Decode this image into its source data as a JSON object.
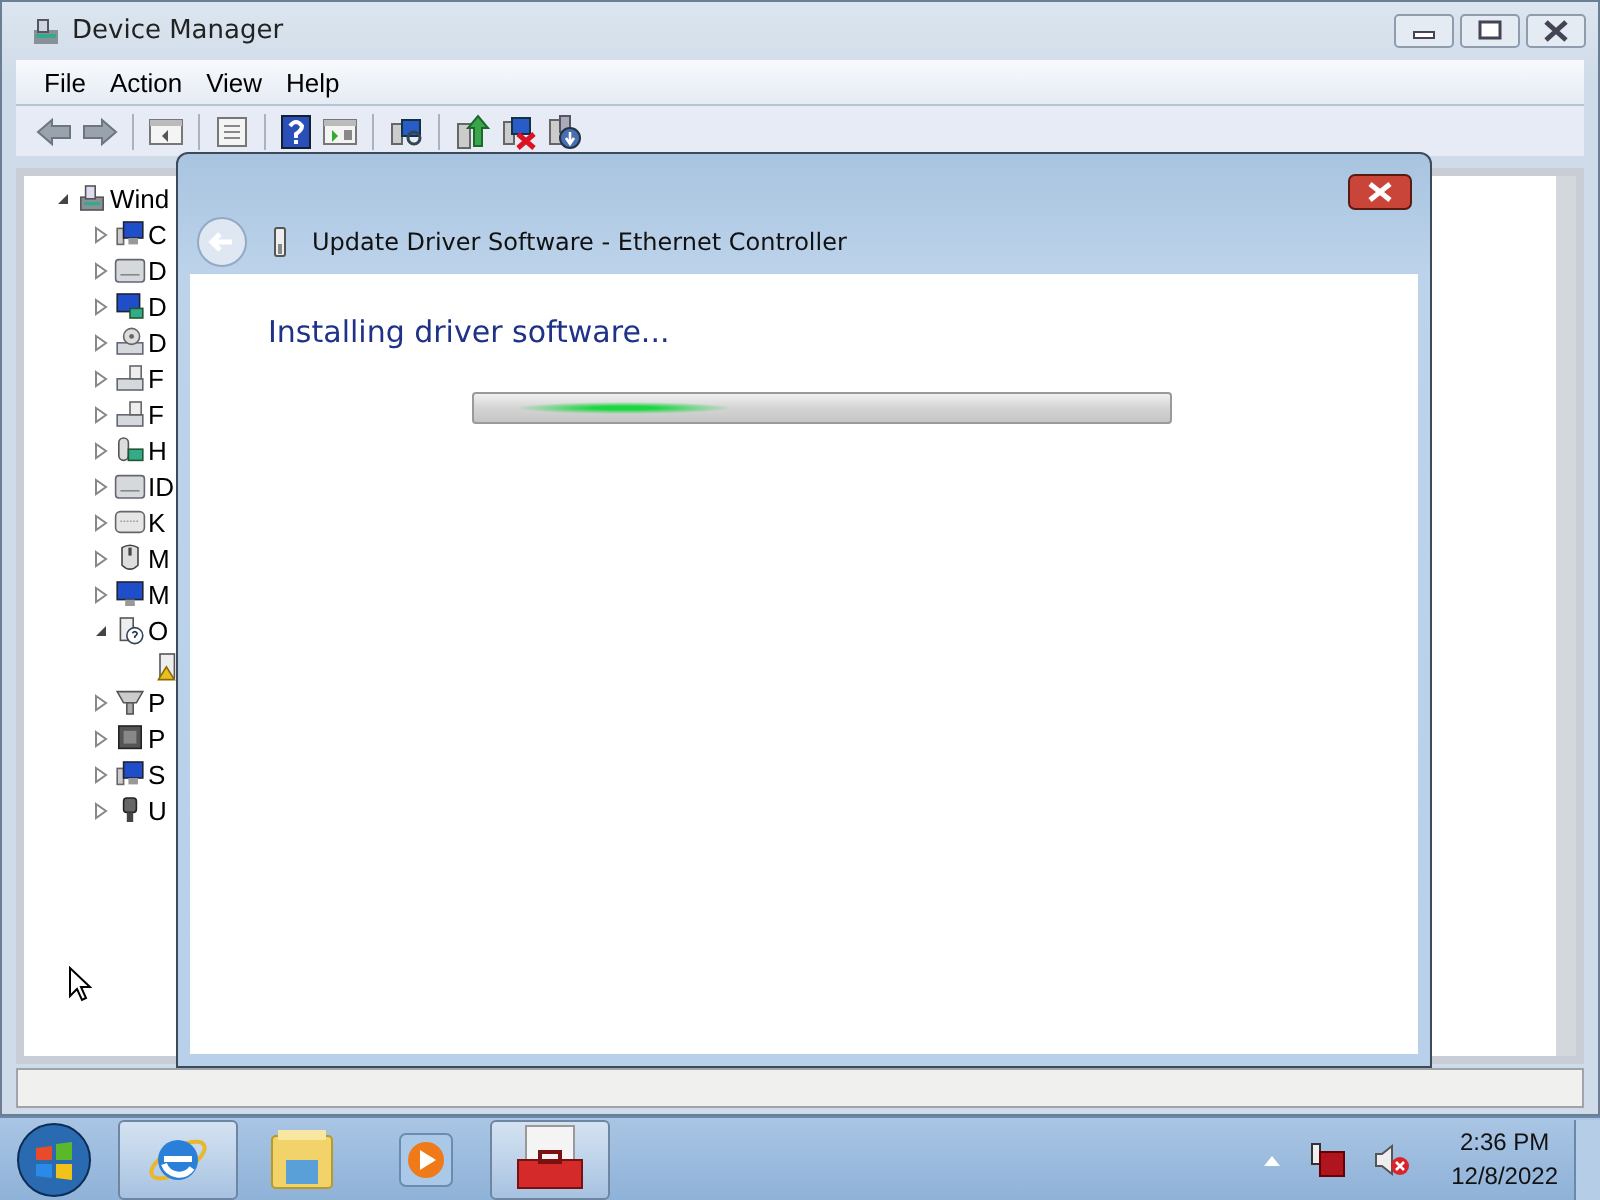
{
  "main_window": {
    "title": "Device Manager",
    "menu": [
      "File",
      "Action",
      "View",
      "Help"
    ],
    "tree": [
      {
        "label": "Wind",
        "kind": "computer-root",
        "expanded": true,
        "children": [
          {
            "label": "C",
            "kind": "computer",
            "expanded": false
          },
          {
            "label": "D",
            "kind": "disk",
            "expanded": false
          },
          {
            "label": "D",
            "kind": "display",
            "expanded": false
          },
          {
            "label": "D",
            "kind": "dvd",
            "expanded": false
          },
          {
            "label": "F",
            "kind": "floppy",
            "expanded": false
          },
          {
            "label": "F",
            "kind": "floppy",
            "expanded": false
          },
          {
            "label": "H",
            "kind": "hid",
            "expanded": false
          },
          {
            "label": "ID",
            "kind": "disk",
            "expanded": false
          },
          {
            "label": "K",
            "kind": "keyboard",
            "expanded": false
          },
          {
            "label": "M",
            "kind": "mouse",
            "expanded": false
          },
          {
            "label": "M",
            "kind": "monitor",
            "expanded": false
          },
          {
            "label": "O",
            "kind": "other",
            "expanded": true,
            "children": [
              {
                "kind": "unknown"
              }
            ]
          },
          {
            "label": "P",
            "kind": "port",
            "expanded": false
          },
          {
            "label": "P",
            "kind": "processor",
            "expanded": false
          },
          {
            "label": "S",
            "kind": "computer",
            "expanded": false
          },
          {
            "label": "U",
            "kind": "usb",
            "expanded": false
          }
        ]
      }
    ]
  },
  "dialog": {
    "title": "Update Driver Software - Ethernet Controller",
    "heading": "Installing driver software...",
    "progress": {
      "indeterminate": true
    }
  },
  "taskbar": {
    "items": [
      {
        "kind": "browser",
        "running": true
      },
      {
        "kind": "folder",
        "running": false
      },
      {
        "kind": "media",
        "running": false
      },
      {
        "kind": "toolbox",
        "running": true
      }
    ],
    "time": "2:36 PM",
    "date": "12/8/2022"
  }
}
